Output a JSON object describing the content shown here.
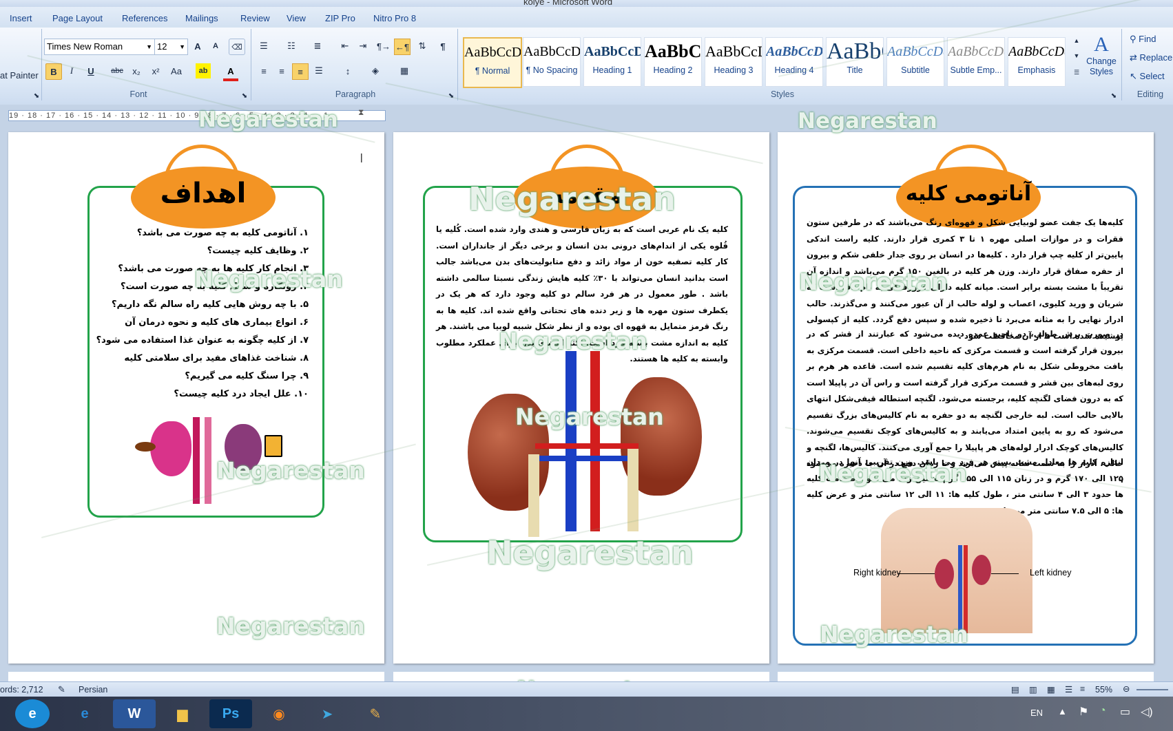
{
  "window": {
    "title": "kolye - Microsoft Word"
  },
  "tabs": [
    "Insert",
    "Page Layout",
    "References",
    "Mailings",
    "Review",
    "View",
    "ZIP Pro",
    "Nitro Pro 8"
  ],
  "ribbon": {
    "clipboard": {
      "format_painter": "at Painter"
    },
    "font": {
      "label": "Font",
      "family": "Times New Roman",
      "size": "12",
      "grow": "A",
      "shrink": "A",
      "bold": "B",
      "italic": "I",
      "underline": "U",
      "strike": "abc",
      "subscript": "x₂",
      "superscript": "x²",
      "change_case": "Aa"
    },
    "paragraph": {
      "label": "Paragraph"
    },
    "styles": {
      "label": "Styles",
      "items": [
        {
          "preview": "AaBbCcDdEe",
          "name": "¶ Normal"
        },
        {
          "preview": "AaBbCcDdEe",
          "name": "¶ No Spacing"
        },
        {
          "preview": "AaBbCcDdEe",
          "name": "Heading 1"
        },
        {
          "preview": "AaBbCcDdEe",
          "name": "Heading 2"
        },
        {
          "preview": "AaBbCcDdEe",
          "name": "Heading 3"
        },
        {
          "preview": "AaBbCcDdEe",
          "name": "Heading 4"
        },
        {
          "preview": "AaBbCcDdEe",
          "name": "Title"
        },
        {
          "preview": "AaBbCcDdEe",
          "name": "Subtitle"
        },
        {
          "preview": "AaBbCcDdEe",
          "name": "Subtle Emp..."
        },
        {
          "preview": "AaBbCcDdEe",
          "name": "Emphasis"
        }
      ],
      "change_styles": "Change Styles"
    },
    "editing": {
      "label": "Editing",
      "find": "Find",
      "replace": "Replace",
      "select": "Select"
    }
  },
  "ruler": {
    "marks": "19 · 18 · 17 · 16 · 15 · 14 · 13 · 12 · 11 · 10 · 9 · 8 · 7 · 6 · 5 · 4 · 3 · 2 · 1 · · 1"
  },
  "pages": {
    "left": {
      "title": "اهداف",
      "items": [
        "۱.  آناتومی کلیه به چه صورت می باشد؟",
        "۲.  وظایف کلیه چیست؟",
        "۳.  انجام کار کلیه ها به چه صورت می باشد؟",
        "۴.  روتکاره و شکل کلیه به چه صورت است؟",
        "۵.  با چه روش هایی کلیه راه سالم نگه داریم؟",
        "۶.  انواع بیماری های کلیه و نحوه درمان آن",
        "۷.  از کلیه چگونه به عنوان غذا استفاده می شود؟",
        "۸.  شناخت غذاهای مفید برای سلامتی کلیه",
        "۹.  چرا سنگ کلیه می گیریم؟",
        "۱۰.  علل ایجاد درد کلیه چیست؟"
      ]
    },
    "middle": {
      "title": "مقدمه",
      "paragraph": "کلیه یک نام عربی است که به زبان فارسی و هندی وارد شده است. کُلیه یا قُلوه یکی از اندام‌های درونی بدن انسان و برخی دیگر از جانداران است. کار کلیه تصفیه خون از مواد زائد و دفع متابولیت‌های بدن می‌باشد جالب است بدانید انسان می‌تواند با ۳۰٪ کلیه هایش زندگی نسبتا سالمی داشته باشد . طور معمول در هر فرد سالم دو کلیه وجود دارد که هر یک در یکطرف ستون مهره ها و زیر دنده های تحتانی واقع شده اند. کلیه ها به رنگ قرمز متمایل به قهوه ای بوده و از نظر شکل شبیه لوبیا می باشند. هر کلیه به اندازه مشت بسته فرد است. اکثر اعضای بدن برای عملکرد مطلوب وابسته به کلیه ها هستند."
    },
    "right": {
      "title": "آناتومی کلیه",
      "paragraph1": "کلیه‌ها یک جفت عضو لوبیایی شکل و قهوه‌ای رنگ می‌باشند که در طرفین ستون فقرات و در موازات اصلی مهره ۱ تا ۳ کمری قرار دارند. کلیه راست اندکی پایین‌تر از کلیه چپ قرار دارد . کلیه‌ها در انسان بر روی جدار خلفی شکم و بیرون از حفره صفاق قرار دارند. وزن هر کلیه در بالغین ۱۵۰ گرم می‌باشد و اندازه آن تقریباً با مشت بسته برابر است. میانه کلیه دارای فرورفتگی به نام ناف است که شریان و ورید کلیوی، اعصاب و لوله حالب از آن عبور می‌کنند و می‌گذرند. حالب ادرار نهایی را به مثانه می‌برد تا ذخیره شده و سپس دفع گردد. کلیه از کپسولی پوشیده شده است تا از آن محافظت شود .",
      "paragraph2": "در صورت برش طولی، دو ناحیه عمده دیده می‌شود که عبارتند از قشر که در بیرون قرار گرفته است و قسمت مرکزی که ناحیه داخلی است. قسمت مرکزی به بافت مخروطی شکل به نام هرم‌های کلیه تقسیم شده است. قاعده هر هرم بر روی لبه‌های بین قشر و قسمت مرکزی قرار گرفته است و راس آن در پاپیلا است که به درون فضای لگنچه کلیه، برجسته می‌شود. لگنچه استطاله قیفی‌شکل انتهای بالایی حالب است. لبه خارجی لگنچه به دو حفره به نام کالیس‌های بزرگ تقسیم می‌شود که رو به پایین امتداد می‌یابند و به کالیس‌های کوچک تقسیم می‌شوند. کالیس‌های کوچک ادرار لوله‌های هر پاپیلا را جمع آوری می‌کنند. کالیس‌ها، لگنچه و حالب، ادرار را به سمت مثانه پیش می‌برند و تا زمان دفع در آن جا ذخیره می‌شود .",
      "paragraph3": "اندازه کلیه ها معادل مشت بسته هر فرد می باشد. وزن تقریبی آنها در مردان ۱۲۵ الی ۱۷۰ گرم و در زنان ۱۱۵ الی ۱۵۵ گرم تخمین زده می شود .ضخامت کلیه ها حدود ۳ الی ۴ سانتی متر ، طول کلیه ها: ۱۱ الی ۱۲ سانتی متر و عرض کلیه ها: ۵ الی ۷.۵ سانتی متر می باشد.",
      "right_kidney_label": "Right kidney",
      "left_kidney_label": "Left kidney"
    }
  },
  "watermark": "Negarestan",
  "status": {
    "words": "ords: 2,712",
    "language": "Persian",
    "zoom": "55%"
  },
  "taskbar": {
    "lang": "EN"
  },
  "colors": {
    "orange": "#f39424",
    "green_frame": "#22a34a",
    "blue_frame": "#2471b5",
    "kidney": "#9b3b24"
  }
}
